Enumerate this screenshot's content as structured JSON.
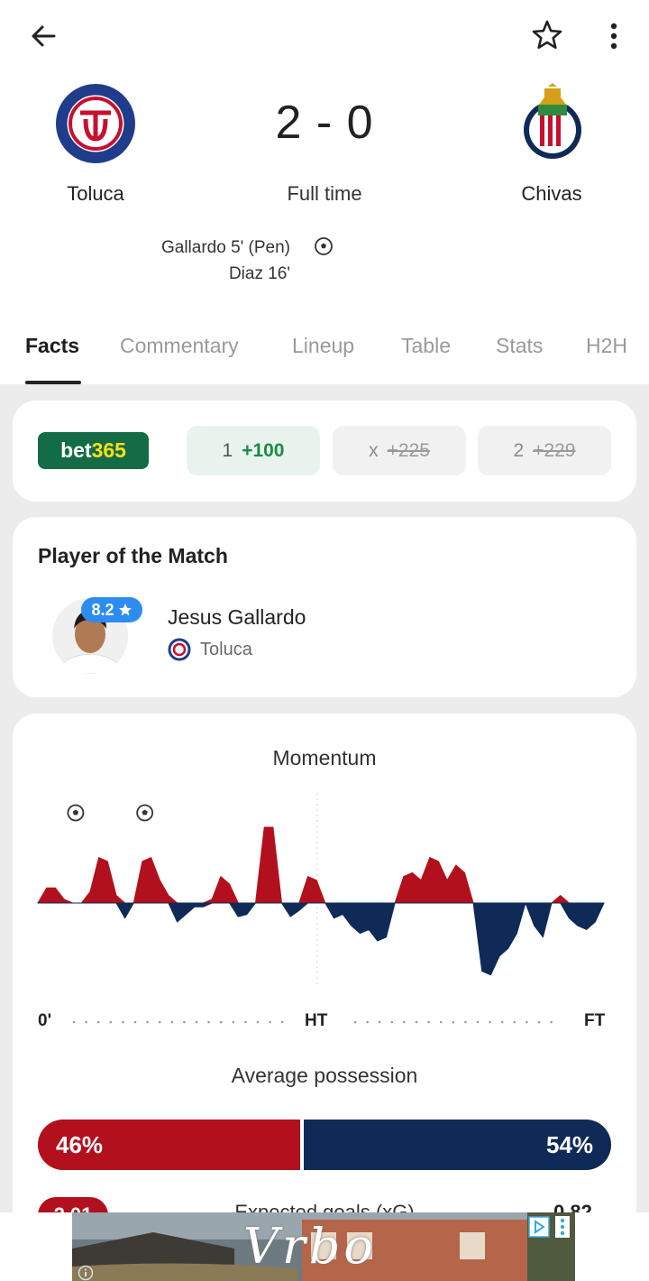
{
  "header": {
    "back_icon": "arrow-left-icon",
    "favorite_icon": "star-outline-icon",
    "more_icon": "more-vertical-icon"
  },
  "match": {
    "home_team": "Toluca",
    "away_team": "Chivas",
    "score": "2 - 0",
    "status": "Full time",
    "home_color": "#b3101d",
    "away_color": "#0f2a57",
    "scorers": [
      "Gallardo 5' (Pen)",
      "Diaz 16'"
    ]
  },
  "tabs": [
    {
      "label": "Facts",
      "active": true
    },
    {
      "label": "Commentary",
      "active": false
    },
    {
      "label": "Lineup",
      "active": false
    },
    {
      "label": "Table",
      "active": false
    },
    {
      "label": "Stats",
      "active": false
    },
    {
      "label": "H2H",
      "active": false
    }
  ],
  "odds": {
    "bookmaker_prefix": "bet",
    "bookmaker_suffix": "365",
    "home": {
      "label": "1",
      "value": "+100"
    },
    "draw": {
      "label": "x",
      "value": "+225"
    },
    "away": {
      "label": "2",
      "value": "+229"
    }
  },
  "player_of_match": {
    "title": "Player of the Match",
    "rating": "8.2",
    "name": "Jesus Gallardo",
    "team": "Toluca"
  },
  "momentum": {
    "title": "Momentum",
    "label_start": "0'",
    "label_half": "HT",
    "label_end": "FT",
    "goal_minutes": [
      5,
      16
    ],
    "values": [
      0,
      0.2,
      0.2,
      0.05,
      0,
      0,
      0.15,
      0.6,
      0.55,
      0.1,
      -0.2,
      0,
      0.55,
      0.6,
      0.3,
      0.1,
      -0.25,
      -0.15,
      -0.05,
      -0.05,
      0.05,
      0.35,
      0.25,
      -0.18,
      -0.15,
      0,
      1.0,
      1.0,
      0,
      -0.18,
      -0.1,
      0.35,
      0.3,
      0,
      -0.2,
      -0.15,
      -0.3,
      -0.4,
      -0.35,
      -0.5,
      -0.45,
      0,
      0.35,
      0.4,
      0.3,
      0.6,
      0.55,
      0.3,
      0.5,
      0.4,
      0,
      -0.9,
      -0.95,
      -0.7,
      -0.6,
      -0.4,
      0,
      -0.3,
      -0.45,
      0,
      0.1,
      -0.2,
      -0.3,
      -0.35,
      -0.25,
      0
    ]
  },
  "possession": {
    "title": "Average possession",
    "home_percent": 46,
    "away_percent": 54,
    "home_label": "46%",
    "away_label": "54%"
  },
  "expected_goals": {
    "title": "Expected goals (xG)",
    "home": "2.01",
    "away": "0.82"
  },
  "ad": {
    "text": "Vrbo"
  }
}
